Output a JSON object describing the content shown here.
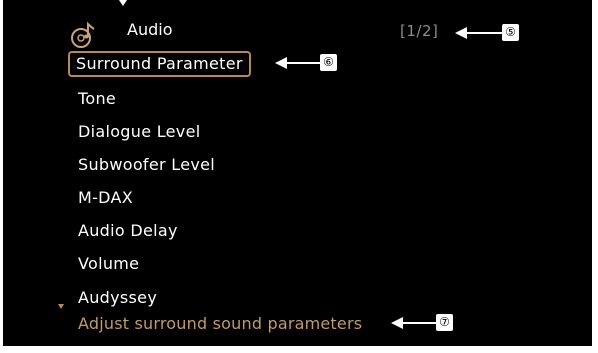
{
  "header": {
    "icon": "music-note-disc-icon",
    "title": "Audio",
    "page_indicator": "[1/2]"
  },
  "menu": {
    "items": [
      {
        "label": "Surround Parameter",
        "selected": true
      },
      {
        "label": "Tone"
      },
      {
        "label": "Dialogue Level"
      },
      {
        "label": "Subwoofer Level"
      },
      {
        "label": "M-DAX"
      },
      {
        "label": "Audio Delay"
      },
      {
        "label": "Volume"
      },
      {
        "label": "Audyssey"
      }
    ]
  },
  "help_text": "Adjust surround sound parameters",
  "callouts": {
    "c5": "⑤",
    "c6": "⑥",
    "c7": "⑦"
  },
  "colors": {
    "background": "#000000",
    "accent": "#b9885a",
    "text": "#ffffff",
    "muted": "#8c8c8c"
  }
}
